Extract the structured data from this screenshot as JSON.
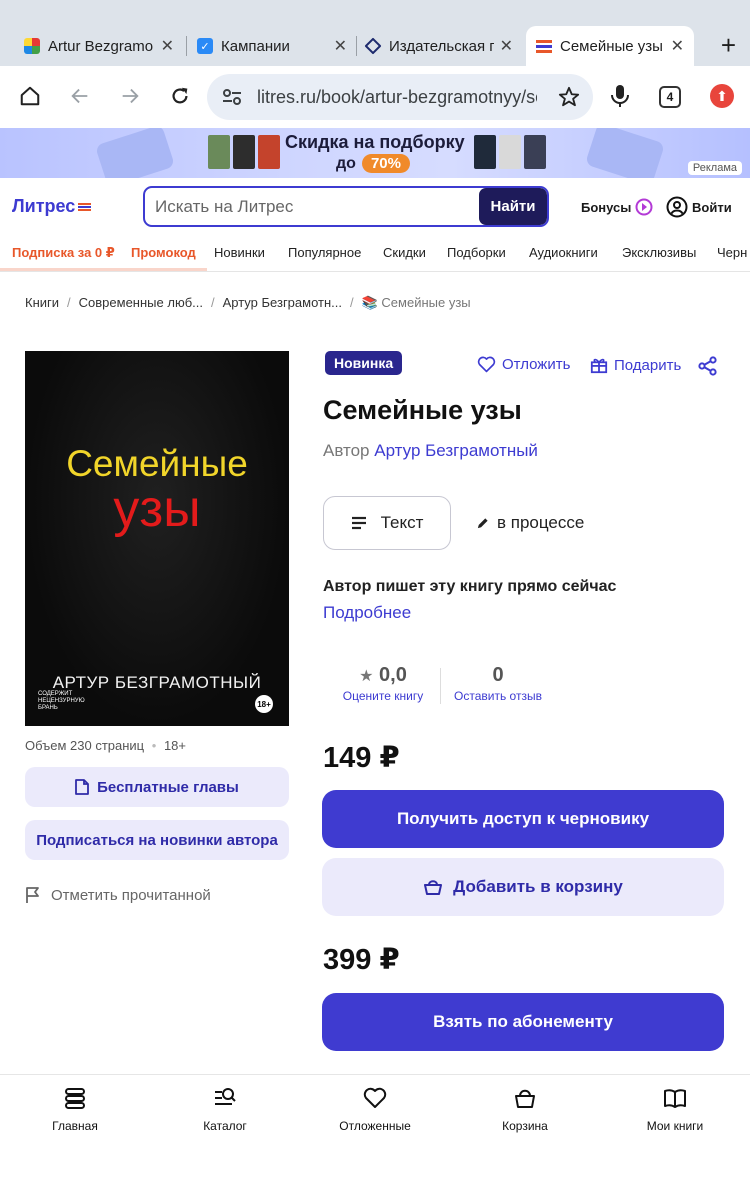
{
  "browser": {
    "tabs": [
      {
        "title": "Artur Bezgramo"
      },
      {
        "title": "Кампании"
      },
      {
        "title": "Издательская п"
      },
      {
        "title": "Семейные узы /"
      }
    ],
    "url": "litres.ru/book/artur-bezgramotnyy/se",
    "tab_count": "4"
  },
  "banner": {
    "title": "Скидка на подборку",
    "prefix": "до",
    "percent": "70%",
    "ad_label": "Реклама"
  },
  "header": {
    "logo": "Литрес",
    "search_placeholder": "Искать на Литрес",
    "search_button": "Найти",
    "bonus_label": "Бонусы",
    "login_label": "Войти"
  },
  "nav": {
    "subscription": "Подписка за 0 ₽",
    "promo": "Промокод",
    "items": [
      "Новинки",
      "Популярное",
      "Скидки",
      "Подборки",
      "Аудиокниги",
      "Эксклюзивы",
      "Черн"
    ]
  },
  "breadcrumbs": [
    "Книги",
    "Современные люб...",
    "Артур Безграмотн...",
    "📚 Семейные узы"
  ],
  "cover": {
    "title_line1": "Семейные",
    "title_line2": "узы",
    "author": "АРТУР БЕЗГРАМОТНЫЙ",
    "warning": "СОДЕРЖИТ НЕЦЕНЗУРНУЮ БРАНЬ",
    "age": "18+"
  },
  "book": {
    "badge": "Новинка",
    "save_label": "Отложить",
    "gift_label": "Подарить",
    "title": "Семейные узы",
    "author_prefix": "Автор",
    "author": "Артур Безграмотный",
    "format": "Текст",
    "status": "в процессе",
    "writing_note": "Автор пишет эту книгу прямо сейчас",
    "more_link": "Подробнее",
    "volume": "Объем 230 страниц",
    "age": "18+",
    "rating": "0,0",
    "rating_label": "Оцените книгу",
    "reviews": "0",
    "reviews_label": "Оставить отзыв"
  },
  "left_actions": {
    "free_chapters": "Бесплатные главы",
    "subscribe_author": "Подписаться на новинки автора",
    "mark_read": "Отметить прочитанной"
  },
  "purchase": {
    "price1": "149 ₽",
    "draft_access": "Получить доступ к черновику",
    "add_to_cart": "Добавить в корзину",
    "price2": "399 ₽",
    "subscription_button": "Взять по абонементу"
  },
  "bottom_nav": [
    {
      "label": "Главная",
      "icon": "home-icon"
    },
    {
      "label": "Каталог",
      "icon": "catalog-search-icon"
    },
    {
      "label": "Отложенные",
      "icon": "heart-icon"
    },
    {
      "label": "Корзина",
      "icon": "basket-icon"
    },
    {
      "label": "Мои книги",
      "icon": "book-icon"
    }
  ],
  "colors": {
    "accent": "#3f3bd0",
    "accent_dark": "#1e1b5a",
    "promo_orange": "#e8572a",
    "cover_yellow": "#f1d52a",
    "cover_red": "#e31b1b"
  }
}
